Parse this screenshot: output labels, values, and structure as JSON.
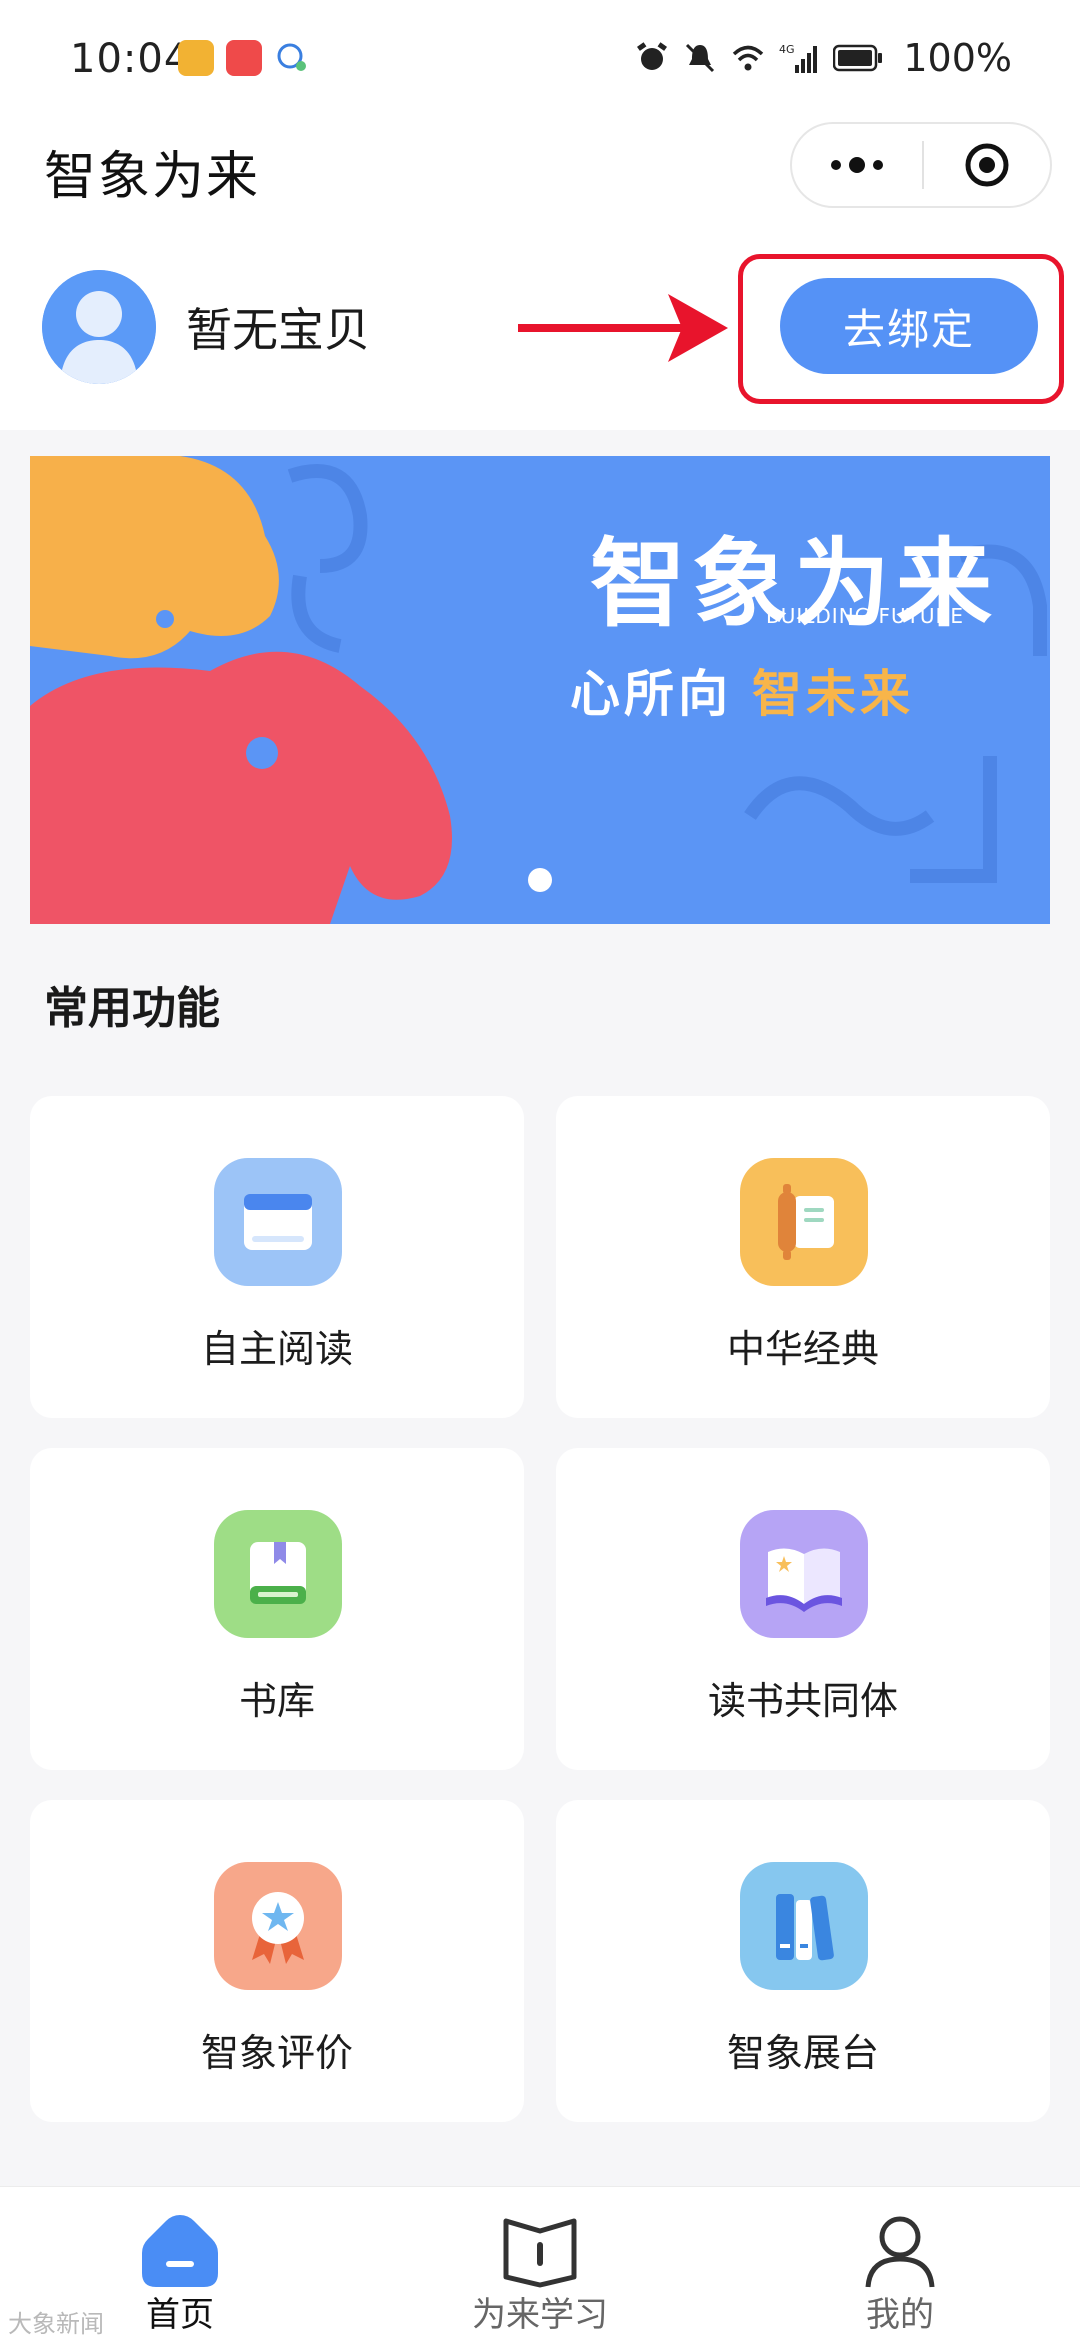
{
  "status_bar": {
    "time": "10:04",
    "battery": "100%",
    "network": "4G"
  },
  "header": {
    "title": "智象为来"
  },
  "profile": {
    "baby_name": "暂无宝贝",
    "bind_button": "去绑定"
  },
  "banner": {
    "brand": "智象为来",
    "brand_en": "BUILDING FUTURE",
    "slogan_a": "心所向",
    "slogan_b": "智未来",
    "page_count": 1
  },
  "section": {
    "title": "常用功能"
  },
  "features": [
    {
      "label": "自主阅读",
      "icon": "window-icon",
      "color": "#9cc4f7"
    },
    {
      "label": "中华经典",
      "icon": "scroll-icon",
      "color": "#f8bf5a"
    },
    {
      "label": "书库",
      "icon": "book-library-icon",
      "color": "#9edd86"
    },
    {
      "label": "读书共同体",
      "icon": "open-book-icon",
      "color": "#b6a4f5"
    },
    {
      "label": "智象评价",
      "icon": "badge-icon",
      "color": "#f7a78a"
    },
    {
      "label": "智象展台",
      "icon": "bookshelf-icon",
      "color": "#86c7ef"
    }
  ],
  "bottom_nav": [
    {
      "label": "首页",
      "icon": "home-icon",
      "active": true
    },
    {
      "label": "为来学习",
      "icon": "study-book-icon",
      "active": false
    },
    {
      "label": "我的",
      "icon": "profile-icon",
      "active": false
    }
  ],
  "watermark": "大象新闻",
  "colors": {
    "accent": "#5592f6",
    "highlight_red": "#e8142c"
  }
}
